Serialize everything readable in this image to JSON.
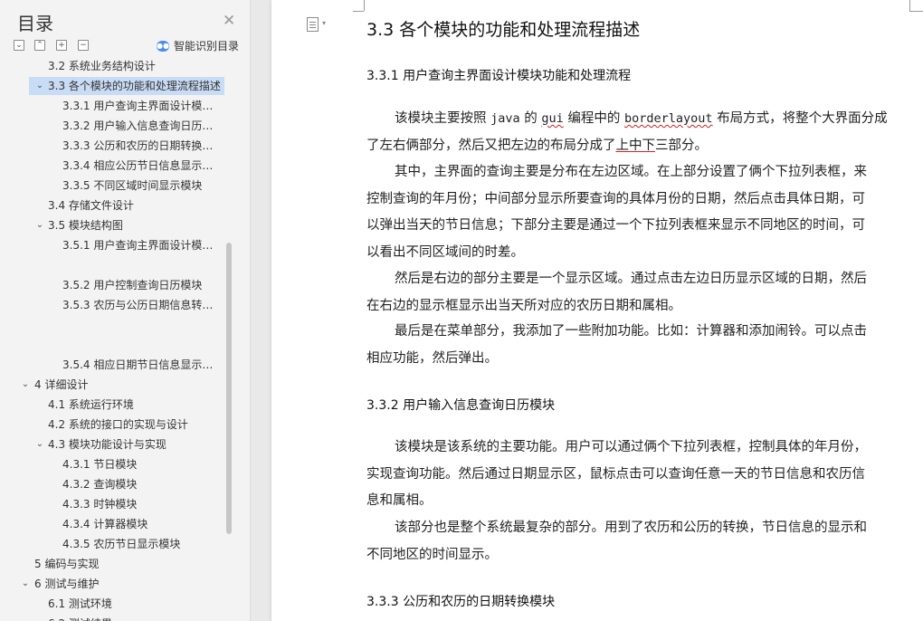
{
  "toc": {
    "title": "目录",
    "smart_label": "智能识别目录",
    "items": [
      {
        "label": "3.2 系统业务结构设计",
        "level": 2,
        "chev": "",
        "partial": true
      },
      {
        "label": "3.3 各个模块的功能和处理流程描述",
        "level": 2,
        "chev": "⌄",
        "selected": true
      },
      {
        "label": "3.3.1 用户查询主界面设计模块功能和处理流程",
        "level": 3,
        "chev": ""
      },
      {
        "label": "3.3.2 用户输入信息查询日历模块",
        "level": 3,
        "chev": ""
      },
      {
        "label": "3.3.3 公历和农历的日期转换模块",
        "level": 3,
        "chev": ""
      },
      {
        "label": "3.3.4 相应公历节日信息显示模块",
        "level": 3,
        "chev": ""
      },
      {
        "label": "3.3.5  不同区域时间显示模块",
        "level": 3,
        "chev": ""
      },
      {
        "label": "3.4 存储文件设计",
        "level": 2,
        "chev": ""
      },
      {
        "label": "3.5  模块结构图",
        "level": 2,
        "chev": "⌄"
      },
      {
        "label": "3.5.1  用户查询主界面设计模块功能和处理流程",
        "level": 3,
        "chev": ""
      },
      {
        "label": "",
        "level": 3,
        "chev": ""
      },
      {
        "label": "3.5.2  用户控制查询日历模块",
        "level": 3,
        "chev": ""
      },
      {
        "label": "3.5.3 农历与公历日期信息转换模块",
        "level": 3,
        "chev": ""
      },
      {
        "label": "",
        "level": 3,
        "chev": ""
      },
      {
        "label": "",
        "level": 3,
        "chev": ""
      },
      {
        "label": "3.5.4 相应日期节日信息显示模块",
        "level": 3,
        "chev": ""
      },
      {
        "label": "4  详细设计",
        "level": 1,
        "chev": "⌄"
      },
      {
        "label": "4.1  系统运行环境",
        "level": 2,
        "chev": ""
      },
      {
        "label": "4.2  系统的接口的实现与设计",
        "level": 2,
        "chev": ""
      },
      {
        "label": "4.3 模块功能设计与实现",
        "level": 2,
        "chev": "⌄"
      },
      {
        "label": "4.3.1  节日模块",
        "level": 3,
        "chev": ""
      },
      {
        "label": "4.3.2  查询模块",
        "level": 3,
        "chev": ""
      },
      {
        "label": "4.3.3  时钟模块",
        "level": 3,
        "chev": ""
      },
      {
        "label": "4.3.4  计算器模块",
        "level": 3,
        "chev": ""
      },
      {
        "label": "4.3.5  农历节日显示模块",
        "level": 3,
        "chev": ""
      },
      {
        "label": "5  编码与实现",
        "level": 1,
        "chev": ""
      },
      {
        "label": "6  测试与维护",
        "level": 1,
        "chev": "⌄"
      },
      {
        "label": "6.1 测试环境",
        "level": 2,
        "chev": ""
      },
      {
        "label": "6.2 测试结果",
        "level": 2,
        "chev": "",
        "partial": true
      }
    ]
  },
  "doc": {
    "h2": "3.3 各个模块的功能和处理流程描述",
    "s1_title": "3.3.1 用户查询主界面设计模块功能和处理流程",
    "p1": {
      "a": "该模块主要按照 ",
      "java": "java",
      "b": " 的 ",
      "gui": "gui",
      "c": " 编程中的 ",
      "bl": "borderlayout",
      "d": " 布局方式，将整个大界面分成",
      "e": "了左右俩部分，然后又把左边的布局分成了",
      "f": "上中下",
      "g": "三部分。"
    },
    "p2": [
      "其中，主界面的查询主要是分布在左边区域。在上部分设置了俩个下拉列表框，来",
      "控制查询的年月份；中间部分显示所要查询的具体月份的日期，然后点击具体日期，可",
      "以弹出当天的节日信息；下部分主要是通过一个下拉列表框来显示不同地区的时间，可",
      "以看出不同区域间的时差。"
    ],
    "p3": [
      "然后是右边的部分主要是一个显示区域。通过点击左边日历显示区域的日期，然后",
      "在右边的显示框显示出当天所对应的农历日期和属相。"
    ],
    "p4": [
      "最后是在菜单部分，我添加了一些附加功能。比如：计算器和添加闹铃。可以点击",
      "相应功能，然后弹出。"
    ],
    "s2_title": "3.3.2 用户输入信息查询日历模块",
    "p5": [
      "该模块是该系统的主要功能。用户可以通过俩个下拉列表框，控制具体的年月份，",
      "实现查询功能。然后通过日期显示区，鼠标点击可以查询任意一天的节日信息和农历信",
      "息和属相。"
    ],
    "p6": [
      "该部分也是整个系统最复杂的部分。用到了农历和公历的转换，节日信息的显示和",
      "不同地区的时间显示。"
    ],
    "s3_title": "3.3.3 公历和农历的日期转换模块"
  },
  "colors": {
    "selected_bg": "#c9dcf5",
    "smart_icon": "#4a8df0",
    "spell_underline": "#d02020"
  }
}
